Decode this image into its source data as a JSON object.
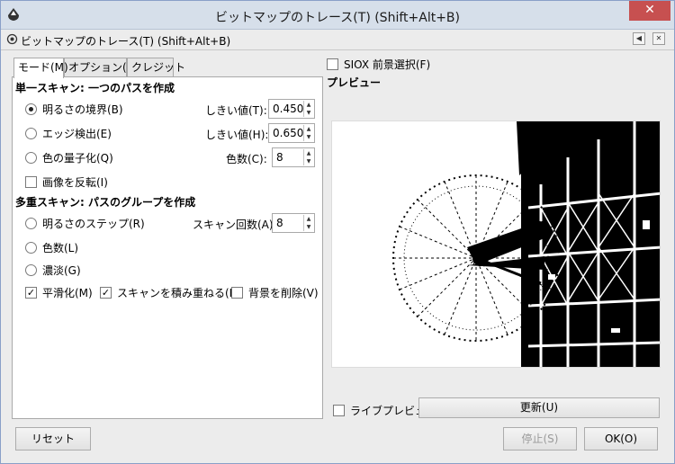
{
  "window": {
    "title": "ビットマップのトレース(T) (Shift+Alt+B)",
    "close_glyph": "✕"
  },
  "dock": {
    "title": "ビットマップのトレース(T) (Shift+Alt+B)",
    "btn1": "◀",
    "btn2": "✕"
  },
  "tabs": [
    "モード(M)",
    "オプション(P)",
    "クレジット"
  ],
  "single_scan": {
    "header": "単一スキャン: 一つのパスを作成",
    "brightness_label": "明るさの境界(B)",
    "brightness_threshold_label": "しきい値(T):",
    "brightness_threshold_value": "0.450",
    "edge_label": "エッジ検出(E)",
    "edge_threshold_label": "しきい値(H):",
    "edge_threshold_value": "0.650",
    "quantize_label": "色の量子化(Q)",
    "colors_label": "色数(C):",
    "colors_value": "8",
    "invert_label": "画像を反転(I)"
  },
  "multi_scan": {
    "header": "多重スキャン: パスのグループを作成",
    "steps_label": "明るさのステップ(R)",
    "scans_label": "スキャン回数(A):",
    "scans_value": "8",
    "colors_label": "色数(L)",
    "grays_label": "濃淡(G)",
    "smooth_label": "平滑化(M)",
    "stack_label": "スキャンを積み重ねる(K)",
    "remove_bg_label": "背景を削除(V)"
  },
  "siox_label": "SIOX 前景選択(F)",
  "preview": {
    "title": "プレビュー",
    "live_label": "ライブプレビュー",
    "update_label": "更新(U)"
  },
  "buttons": {
    "reset": "リセット",
    "stop": "停止(S)",
    "ok": "OK(O)"
  },
  "spin_glyphs": {
    "up": "▲",
    "down": "▼"
  },
  "colors": {
    "titlebar": "#d6dfea",
    "close": "#c75050"
  }
}
